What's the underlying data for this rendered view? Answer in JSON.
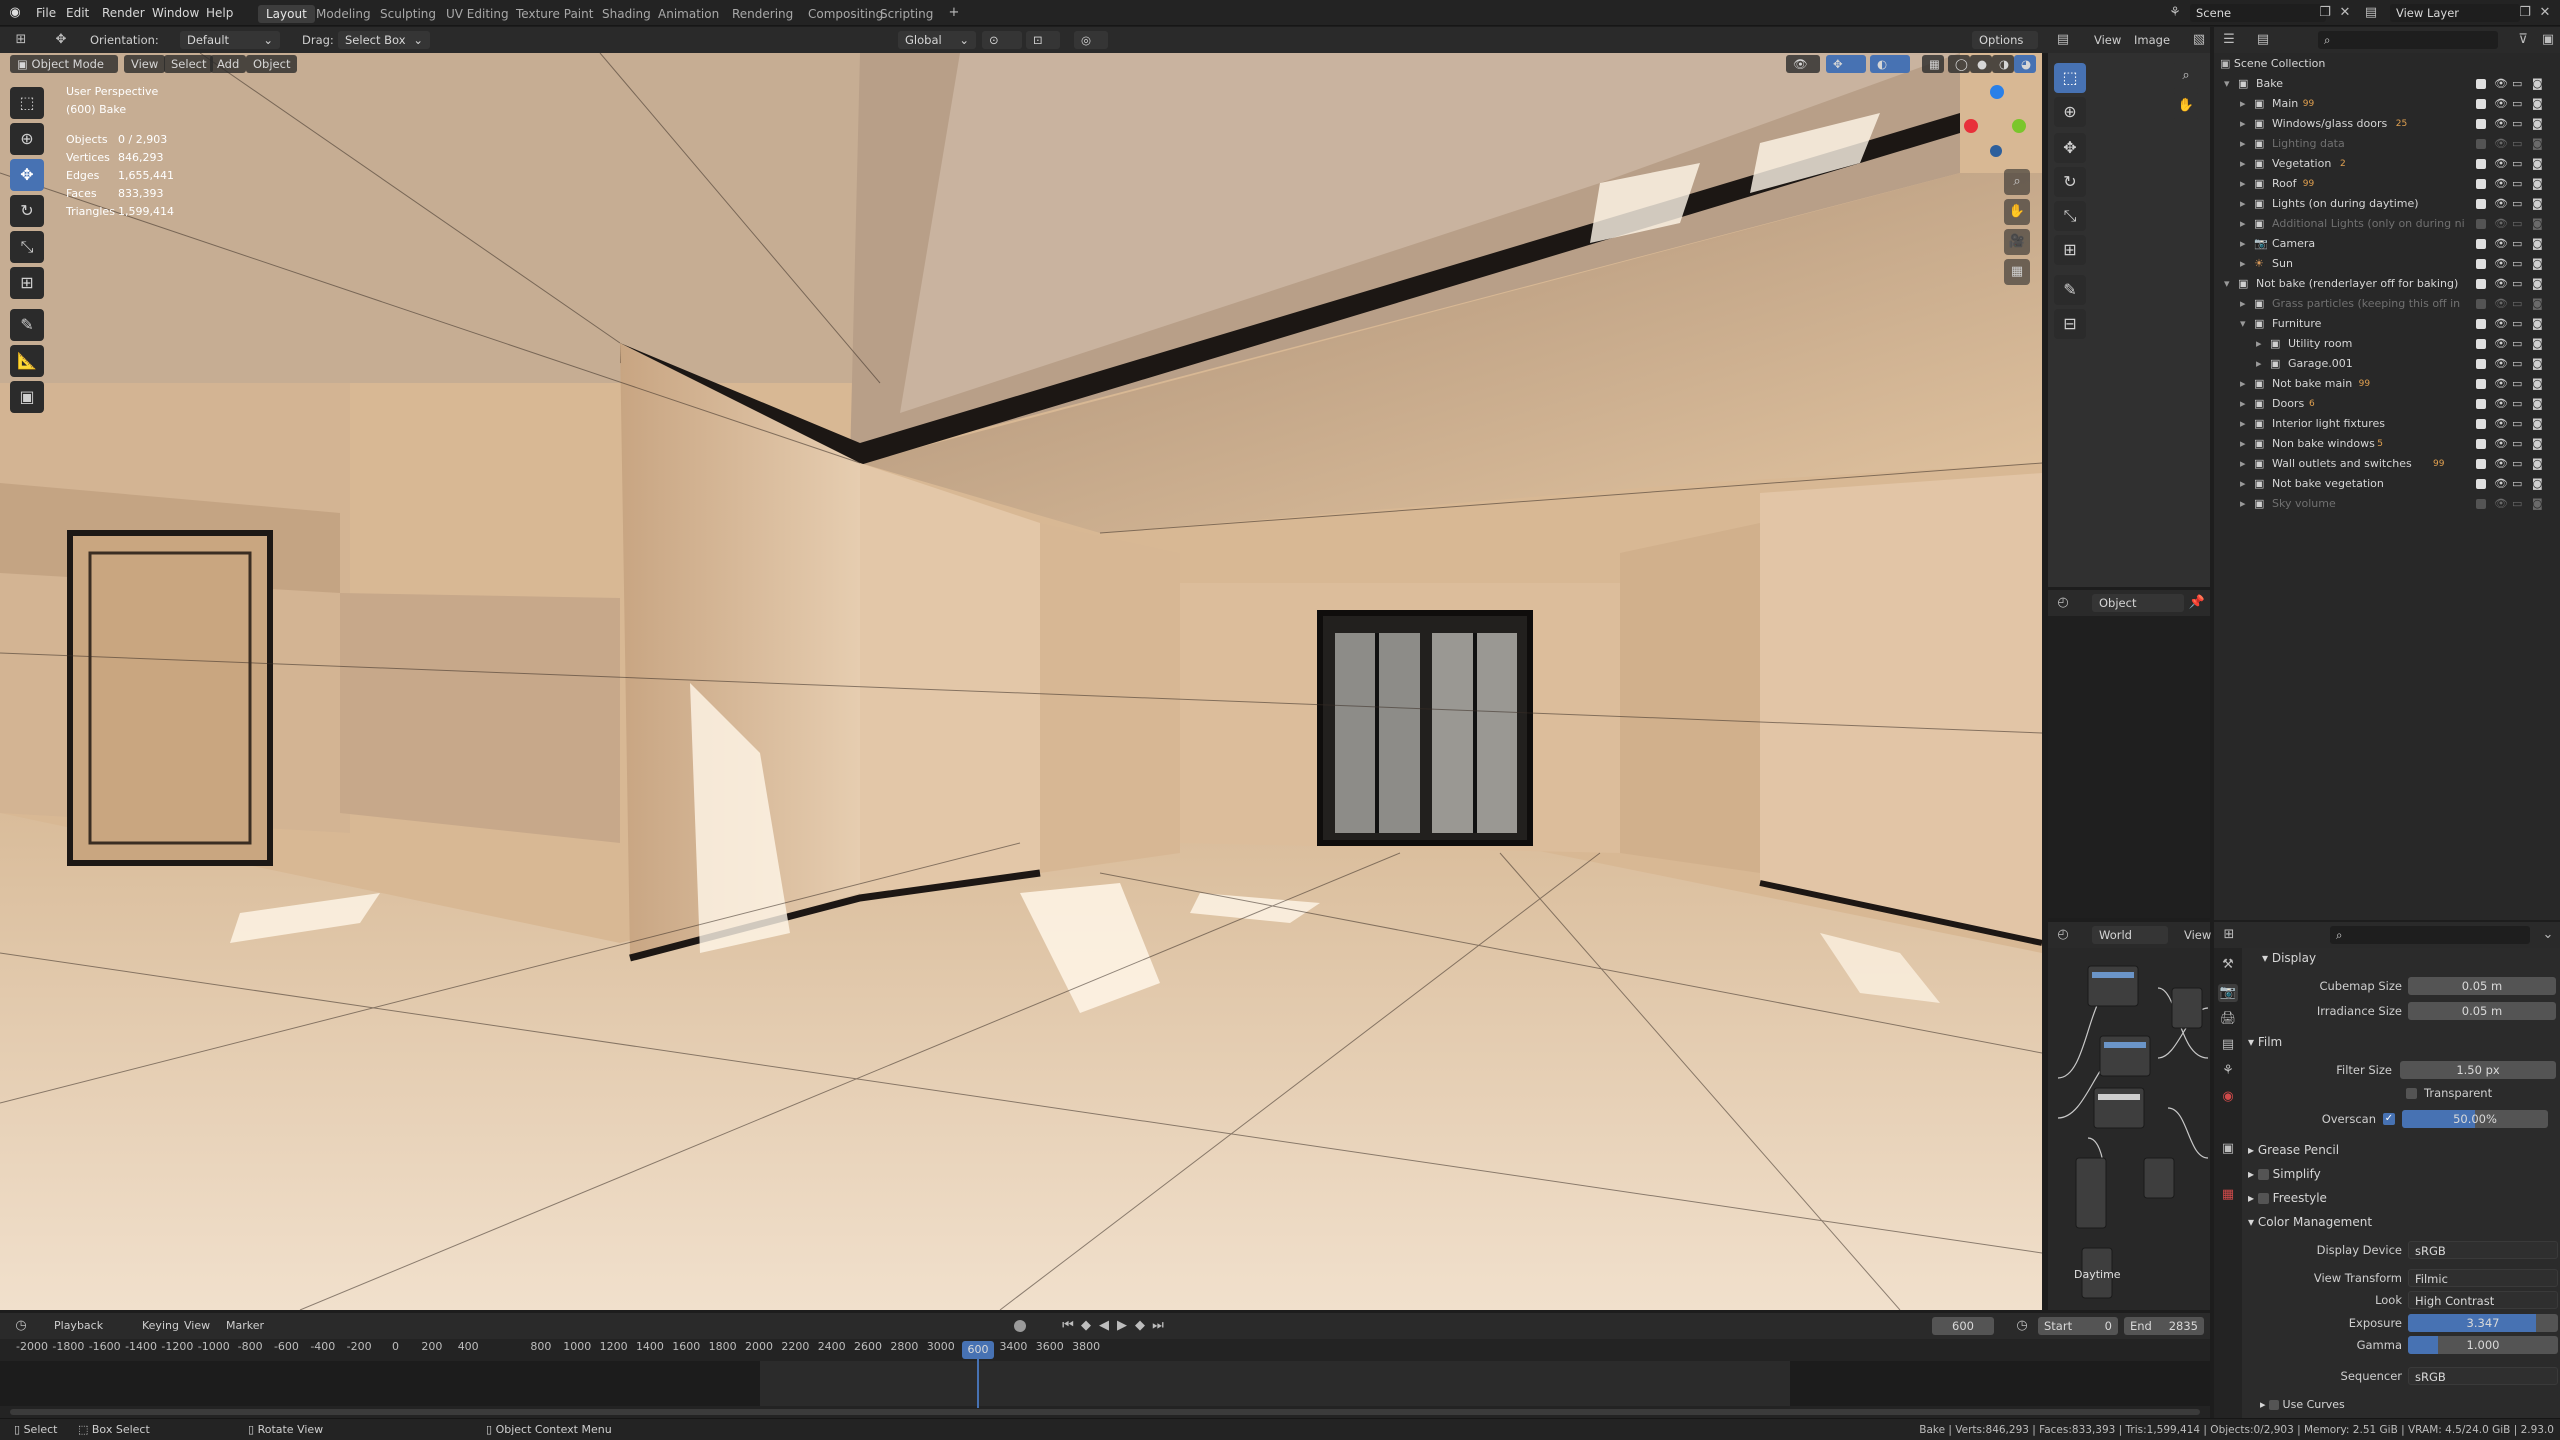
{
  "menus": [
    "File",
    "Edit",
    "Render",
    "Window",
    "Help"
  ],
  "workspaces": [
    "Layout",
    "Modeling",
    "Sculpting",
    "UV Editing",
    "Texture Paint",
    "Shading",
    "Animation",
    "Rendering",
    "Compositing",
    "Scripting"
  ],
  "scene": "Scene",
  "view_layer": "View Layer",
  "viewport_header": {
    "orientation_label": "Orientation:",
    "orientation_value": "Default",
    "drag_label": "Drag:",
    "drag_value": "Select Box",
    "transform_space": "Global",
    "options": "Options"
  },
  "viewport_menu": {
    "mode": "Object Mode",
    "items": [
      "View",
      "Select",
      "Add",
      "Object"
    ]
  },
  "overlay": {
    "title": "User Perspective",
    "subtitle": "(600) Bake",
    "stats": [
      [
        "Objects",
        "0 / 2,903"
      ],
      [
        "Vertices",
        "846,293"
      ],
      [
        "Edges",
        "1,655,441"
      ],
      [
        "Faces",
        "833,393"
      ],
      [
        "Triangles",
        "1,599,414"
      ]
    ]
  },
  "image_editor": {
    "menus": [
      "View",
      "Image"
    ],
    "object_label": "Object"
  },
  "node_editor": {
    "world_label": "World",
    "view_label": "View",
    "node_label": "Daytime"
  },
  "outliner": {
    "title": "Scene Collection",
    "items": [
      {
        "name": "Bake",
        "indent": 1,
        "type": "collection"
      },
      {
        "name": "Main",
        "indent": 2,
        "type": "collection",
        "badge": "99"
      },
      {
        "name": "Windows/glass doors",
        "indent": 2,
        "type": "collection",
        "badge": "25"
      },
      {
        "name": "Lighting data",
        "indent": 2,
        "type": "collection",
        "dim": true
      },
      {
        "name": "Vegetation",
        "indent": 2,
        "type": "collection",
        "badge": "2"
      },
      {
        "name": "Roof",
        "indent": 2,
        "type": "collection",
        "badge": "99"
      },
      {
        "name": "Lights (on during daytime)",
        "indent": 2,
        "type": "collection"
      },
      {
        "name": "Additional Lights (only on during ni",
        "indent": 2,
        "type": "collection",
        "dim": true
      },
      {
        "name": "Camera",
        "indent": 2,
        "type": "camera"
      },
      {
        "name": "Sun",
        "indent": 2,
        "type": "sun"
      },
      {
        "name": "Not bake (renderlayer off for baking)",
        "indent": 1,
        "type": "collection"
      },
      {
        "name": "Grass particles (keeping this off in",
        "indent": 2,
        "type": "collection",
        "dim": true
      },
      {
        "name": "Furniture",
        "indent": 2,
        "type": "collection"
      },
      {
        "name": "Utility room",
        "indent": 3,
        "type": "collection"
      },
      {
        "name": "Garage.001",
        "indent": 3,
        "type": "collection"
      },
      {
        "name": "Not bake main",
        "indent": 2,
        "type": "collection",
        "badge": "99"
      },
      {
        "name": "Doors",
        "indent": 2,
        "type": "collection",
        "badge": "6"
      },
      {
        "name": "Interior light fixtures",
        "indent": 2,
        "type": "collection"
      },
      {
        "name": "Non bake windows",
        "indent": 2,
        "type": "collection",
        "badge": "5"
      },
      {
        "name": "Wall outlets and switches",
        "indent": 2,
        "type": "collection",
        "badge": "99"
      },
      {
        "name": "Not bake vegetation",
        "indent": 2,
        "type": "collection"
      },
      {
        "name": "Sky volume",
        "indent": 2,
        "type": "collection",
        "dim": true
      }
    ]
  },
  "properties": {
    "display_header": "Display",
    "cubemap_label": "Cubemap Size",
    "cubemap_value": "0.05 m",
    "irradiance_label": "Irradiance Size",
    "irradiance_value": "0.05 m",
    "film_header": "Film",
    "filter_label": "Filter Size",
    "filter_value": "1.50 px",
    "transparent_label": "Transparent",
    "overscan_label": "Overscan",
    "overscan_value": "50.00%",
    "overscan_fill": 0.5,
    "grease_pencil": "Grease Pencil",
    "simplify": "Simplify",
    "freestyle": "Freestyle",
    "cm_header": "Color Management",
    "display_device_label": "Display Device",
    "display_device": "sRGB",
    "view_transform_label": "View Transform",
    "view_transform": "Filmic",
    "look_label": "Look",
    "look": "High Contrast",
    "exposure_label": "Exposure",
    "exposure": "3.347",
    "exposure_fill": 0.85,
    "gamma_label": "Gamma",
    "gamma": "1.000",
    "gamma_fill": 0.2,
    "sequencer_label": "Sequencer",
    "sequencer": "sRGB",
    "use_curves": "Use Curves"
  },
  "timeline": {
    "menus": [
      "Playback",
      "Keying",
      "View",
      "Marker"
    ],
    "current": "600",
    "start_label": "Start",
    "start": "0",
    "end_label": "End",
    "end": "2835",
    "ticks": [
      "-2000",
      "-1800",
      "-1600",
      "-1400",
      "-1200",
      "-1000",
      "-800",
      "-600",
      "-400",
      "-200",
      "0",
      "200",
      "400",
      "600",
      "800",
      "1000",
      "1200",
      "1400",
      "1600",
      "1800",
      "2000",
      "2200",
      "2400",
      "2600",
      "2800",
      "3000",
      "3200",
      "3400",
      "3600",
      "3800"
    ]
  },
  "statusbar": {
    "select": "Select",
    "box_select": "Box Select",
    "rotate": "Rotate View",
    "context": "Object Context Menu",
    "stats": "Bake | Verts:846,293 | Faces:833,393 | Tris:1,599,414 | Objects:0/2,903 | Memory: 2.51 GiB | VRAM: 4.5/24.0 GiB | 2.93.0"
  }
}
